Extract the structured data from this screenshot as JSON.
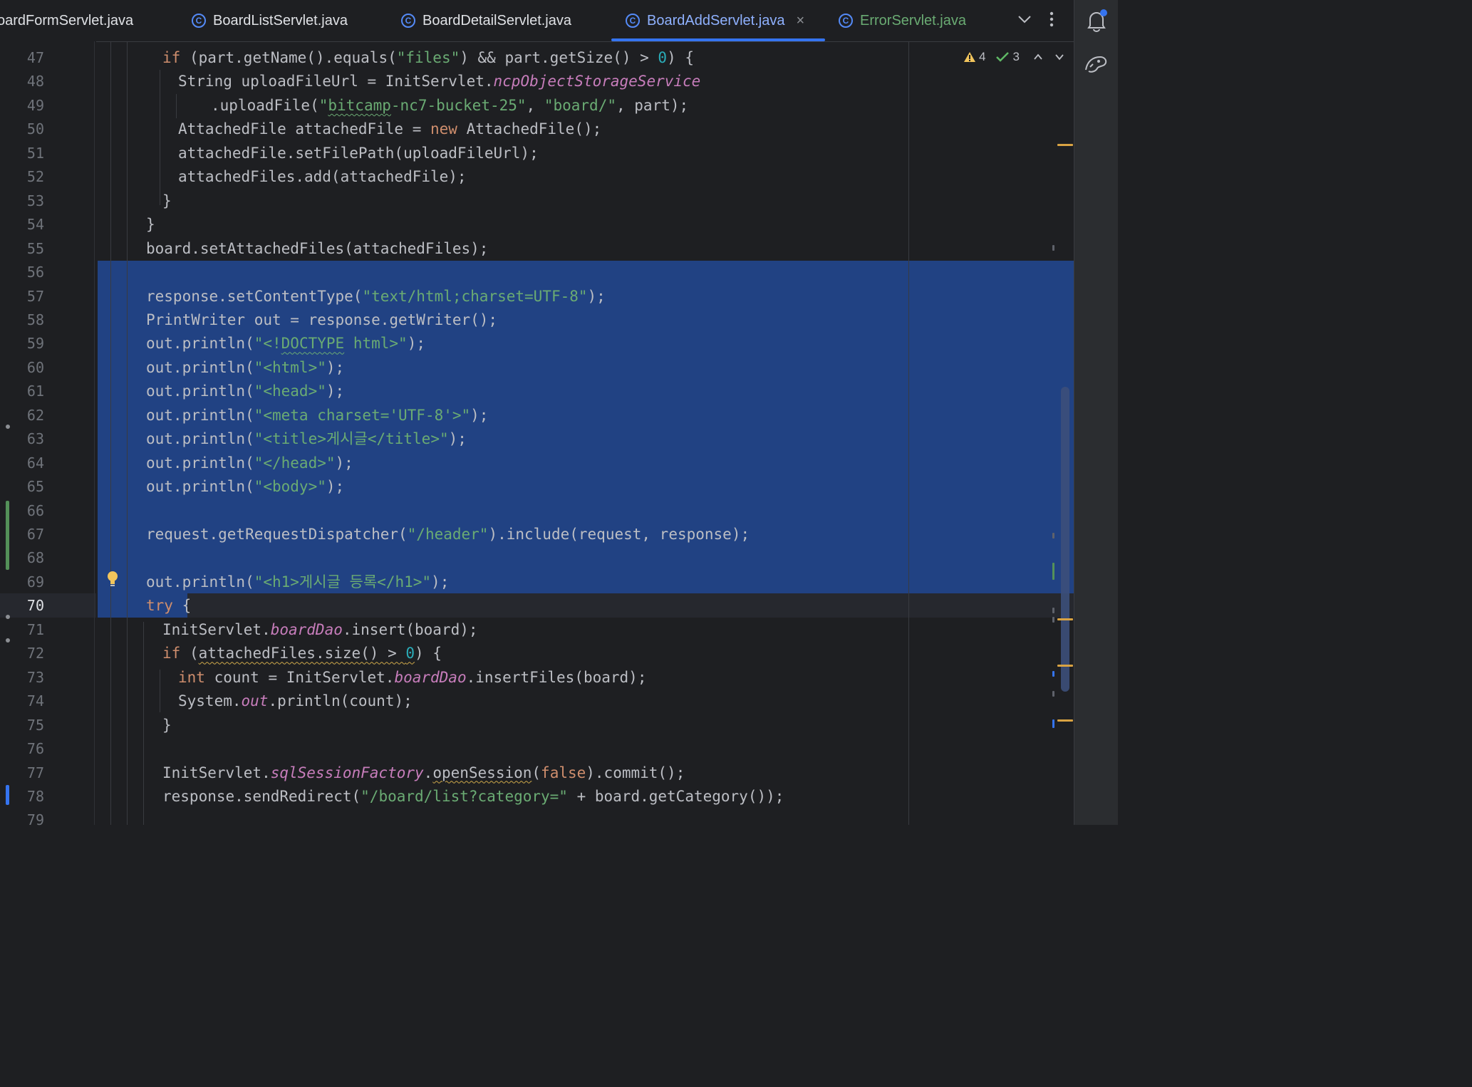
{
  "tabs": [
    {
      "label": "oardFormServlet.java",
      "active": false
    },
    {
      "label": "BoardListServlet.java",
      "active": false
    },
    {
      "label": "BoardDetailServlet.java",
      "active": false
    },
    {
      "label": "BoardAddServlet.java",
      "active": true
    },
    {
      "label": "ErrorServlet.java",
      "active": false
    }
  ],
  "tab_icon_letter": "C",
  "close_glyph": "×",
  "inspections": {
    "warnings": "4",
    "passed": "3"
  },
  "line_numbers": [
    "47",
    "48",
    "49",
    "50",
    "51",
    "52",
    "53",
    "54",
    "55",
    "56",
    "57",
    "58",
    "59",
    "60",
    "61",
    "62",
    "63",
    "64",
    "65",
    "66",
    "67",
    "68",
    "69",
    "70",
    "71",
    "72",
    "73",
    "74",
    "75",
    "76",
    "77",
    "78",
    "79"
  ],
  "current_line": "70",
  "code_lines": [
    {
      "tokens": [
        {
          "t": "if",
          "k": "kw"
        },
        {
          "t": " (part.getName().equals("
        },
        {
          "t": "\"files\"",
          "k": "st"
        },
        {
          "t": ") && part.getSize() > "
        },
        {
          "t": "0",
          "k": "nu"
        },
        {
          "t": ") {"
        }
      ]
    },
    {
      "tokens": [
        {
          "t": "String uploadFileUrl = InitServlet."
        },
        {
          "t": "ncpObjectStorageService",
          "k": "fi"
        }
      ]
    },
    {
      "tokens": [
        {
          "t": ".uploadFile("
        },
        {
          "t": "\"",
          "k": "st"
        },
        {
          "t": "bitcamp",
          "k": "st wavy"
        },
        {
          "t": "-nc7-bucket-25\"",
          "k": "st"
        },
        {
          "t": ", "
        },
        {
          "t": "\"board/\"",
          "k": "st"
        },
        {
          "t": ", part);"
        }
      ]
    },
    {
      "tokens": [
        {
          "t": "AttachedFile attachedFile = "
        },
        {
          "t": "new",
          "k": "kw"
        },
        {
          "t": " AttachedFile();"
        }
      ]
    },
    {
      "tokens": [
        {
          "t": "attachedFile.setFilePath(uploadFileUrl);"
        }
      ]
    },
    {
      "tokens": [
        {
          "t": "attachedFiles.add(attachedFile);"
        }
      ]
    },
    {
      "tokens": [
        {
          "t": "}"
        }
      ]
    },
    {
      "tokens": [
        {
          "t": "}"
        }
      ]
    },
    {
      "tokens": [
        {
          "t": "board.setAttachedFiles(attachedFiles);"
        }
      ]
    },
    {
      "tokens": []
    },
    {
      "tokens": [
        {
          "t": "response.setContentType("
        },
        {
          "t": "\"text/html;charset=UTF-8\"",
          "k": "st"
        },
        {
          "t": ");"
        }
      ]
    },
    {
      "tokens": [
        {
          "t": "PrintWriter out = response.getWriter();"
        }
      ]
    },
    {
      "tokens": [
        {
          "t": "out.println("
        },
        {
          "t": "\"<!",
          "k": "st"
        },
        {
          "t": "DOCTYPE",
          "k": "st wavy"
        },
        {
          "t": " html>\"",
          "k": "st"
        },
        {
          "t": ");"
        }
      ]
    },
    {
      "tokens": [
        {
          "t": "out.println("
        },
        {
          "t": "\"<html>\"",
          "k": "st"
        },
        {
          "t": ");"
        }
      ]
    },
    {
      "tokens": [
        {
          "t": "out.println("
        },
        {
          "t": "\"<head>\"",
          "k": "st"
        },
        {
          "t": ");"
        }
      ]
    },
    {
      "tokens": [
        {
          "t": "out.println("
        },
        {
          "t": "\"<meta charset='UTF-8'>\"",
          "k": "st"
        },
        {
          "t": ");"
        }
      ]
    },
    {
      "tokens": [
        {
          "t": "out.println("
        },
        {
          "t": "\"<title>게시글</title>\"",
          "k": "st"
        },
        {
          "t": ");"
        }
      ]
    },
    {
      "tokens": [
        {
          "t": "out.println("
        },
        {
          "t": "\"</head>\"",
          "k": "st"
        },
        {
          "t": ");"
        }
      ]
    },
    {
      "tokens": [
        {
          "t": "out.println("
        },
        {
          "t": "\"<body>\"",
          "k": "st"
        },
        {
          "t": ");"
        }
      ]
    },
    {
      "tokens": []
    },
    {
      "tokens": [
        {
          "t": "request.getRequestDispatcher("
        },
        {
          "t": "\"/header\"",
          "k": "st"
        },
        {
          "t": ").include(request, response);"
        }
      ]
    },
    {
      "tokens": []
    },
    {
      "tokens": [
        {
          "t": "out.println("
        },
        {
          "t": "\"<h1>게시글 등록</h1>\"",
          "k": "st"
        },
        {
          "t": ");"
        }
      ]
    },
    {
      "tokens": [
        {
          "t": "try",
          "k": "kw"
        },
        {
          "t": " {"
        }
      ]
    },
    {
      "tokens": [
        {
          "t": "InitServlet."
        },
        {
          "t": "boardDao",
          "k": "fi"
        },
        {
          "t": ".insert(board);"
        }
      ]
    },
    {
      "tokens": [
        {
          "t": "if",
          "k": "kw"
        },
        {
          "t": " ("
        },
        {
          "t": "attachedFiles.size() > ",
          "k": "wavy-y"
        },
        {
          "t": "0",
          "k": "nu wavy-y"
        },
        {
          "t": ") {"
        }
      ]
    },
    {
      "tokens": [
        {
          "t": "int",
          "k": "kw"
        },
        {
          "t": " count = InitServlet."
        },
        {
          "t": "boardDao",
          "k": "fi"
        },
        {
          "t": ".insertFiles(board);"
        }
      ]
    },
    {
      "tokens": [
        {
          "t": "System."
        },
        {
          "t": "out",
          "k": "fi"
        },
        {
          "t": ".println(count);"
        }
      ]
    },
    {
      "tokens": [
        {
          "t": "}"
        }
      ]
    },
    {
      "tokens": []
    },
    {
      "tokens": [
        {
          "t": "InitServlet."
        },
        {
          "t": "sqlSessionFactory",
          "k": "fi"
        },
        {
          "t": "."
        },
        {
          "t": "openSession",
          "k": "wavy-y"
        },
        {
          "t": "("
        },
        {
          "t": "false",
          "k": "kw"
        },
        {
          "t": ").commit();"
        }
      ]
    },
    {
      "tokens": [
        {
          "t": "response.sendRedirect("
        },
        {
          "t": "\"/board/list?category=\"",
          "k": "st"
        },
        {
          "t": " + board.getCategory());"
        }
      ]
    },
    {
      "tokens": []
    }
  ],
  "colors": {
    "background": "#1e1f22",
    "selection": "#214283",
    "keyword": "#cf8e6d",
    "string": "#6aab73",
    "number": "#2aacb8",
    "field": "#c77dbb",
    "accent": "#3574f0"
  },
  "icons": [
    "c-class-icon",
    "close-icon",
    "chevron-down-icon",
    "kebab-menu-icon",
    "notifications-bell-icon",
    "ai-assistant-icon",
    "warning-icon",
    "check-icon",
    "chevron-up-icon",
    "lightbulb-icon"
  ]
}
